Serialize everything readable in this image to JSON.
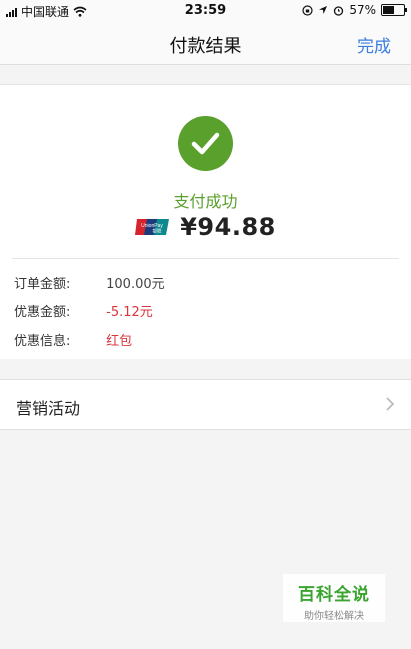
{
  "status_bar": {
    "carrier": "中国联通",
    "time": "23:59",
    "battery_percent": "57%",
    "battery_level": 0.57
  },
  "nav": {
    "title": "付款结果",
    "done_label": "完成"
  },
  "result": {
    "status_text": "支付成功",
    "amount": "¥94.88",
    "card_logo_text": "UnionPay 银联"
  },
  "details": [
    {
      "label": "订单金额:",
      "value": "100.00元",
      "highlight": false
    },
    {
      "label": "优惠金额:",
      "value": "-5.12元",
      "highlight": true
    },
    {
      "label": "优惠信息:",
      "value": "红包",
      "highlight": true
    }
  ],
  "marketing": {
    "label": "营销活动"
  },
  "watermark": {
    "title": "百科全说",
    "subtitle": "助你轻松解决"
  },
  "colors": {
    "success_green": "#5aa02c",
    "link_blue": "#3b7de0",
    "discount_red": "#d8363c"
  },
  "icons": [
    "signal-icon",
    "wifi-icon",
    "lock-rotation-icon",
    "location-icon",
    "alarm-icon",
    "battery-icon",
    "checkmark-icon",
    "unionpay-icon",
    "chevron-right-icon"
  ]
}
